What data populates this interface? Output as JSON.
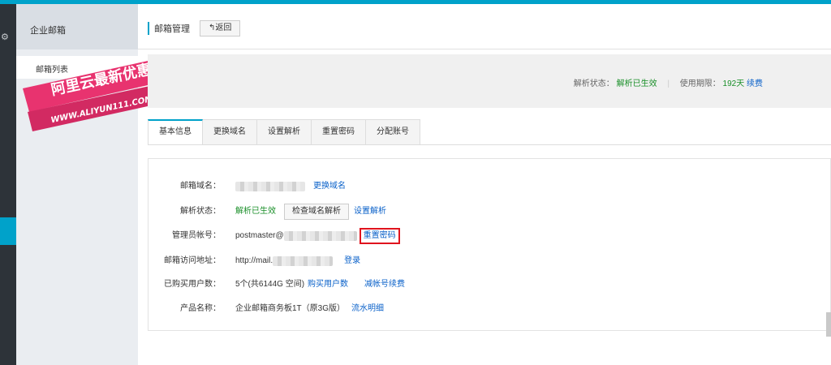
{
  "sidebar": {
    "title": "企业邮箱",
    "items": [
      {
        "label": "邮箱列表"
      }
    ]
  },
  "promo": {
    "line1": "阿里云最新优惠",
    "line2": "WWW.ALIYUN111.COM"
  },
  "header": {
    "title": "邮箱管理",
    "back_label": "返回"
  },
  "status_panel": {
    "dns_label": "解析状态：",
    "dns_value": "解析已生效",
    "period_label": "使用期限：",
    "period_value": "192天",
    "renew_label": "续费"
  },
  "tabs": [
    {
      "label": "基本信息",
      "active": true
    },
    {
      "label": "更换域名",
      "active": false
    },
    {
      "label": "设置解析",
      "active": false
    },
    {
      "label": "重置密码",
      "active": false
    },
    {
      "label": "分配账号",
      "active": false
    }
  ],
  "info": {
    "domain": {
      "label": "邮箱域名：",
      "action": "更换域名"
    },
    "dns": {
      "label": "解析状态：",
      "value": "解析已生效",
      "check_button": "检查域名解析",
      "setup_link": "设置解析"
    },
    "admin": {
      "label": "管理员帐号：",
      "value_prefix": "postmaster@",
      "reset_link": "重置密码"
    },
    "access": {
      "label": "邮箱访问地址：",
      "value_prefix": "http://mail.",
      "login_link": "登录"
    },
    "users": {
      "label": "已购买用户数：",
      "value": "5个(共6144G 空间)",
      "buy_link": "购买用户数",
      "reduce_link": "减帐号续费"
    },
    "product": {
      "label": "产品名称：",
      "value": "企业邮箱商务板1T（原3G版）",
      "flow_link": "流水明细"
    }
  },
  "colors": {
    "accent": "#00a2ca",
    "link": "#0a61c9",
    "success": "#1a8f29",
    "highlight": "#e0141e",
    "promo": "#e8336f"
  }
}
